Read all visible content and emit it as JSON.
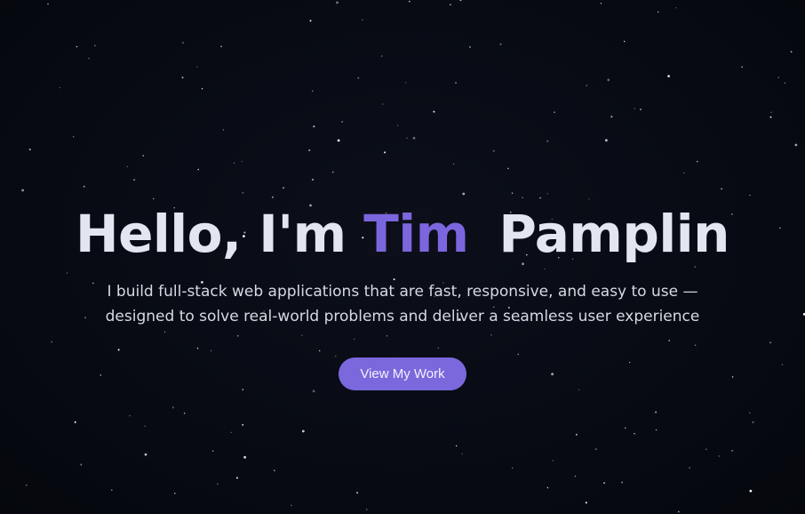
{
  "hero": {
    "greeting": "Hello, I'm",
    "first_name": "Tim",
    "last_name": "Pamplin",
    "subtitle": "I build full-stack web applications that are fast, responsive, and easy to use — designed to solve real-world problems and deliver a seamless user experience",
    "cta_label": "View My Work"
  },
  "colors": {
    "background": "#070a12",
    "accent": "#7c66de",
    "button": "#7a68dc",
    "text": "#e3e6f0"
  }
}
